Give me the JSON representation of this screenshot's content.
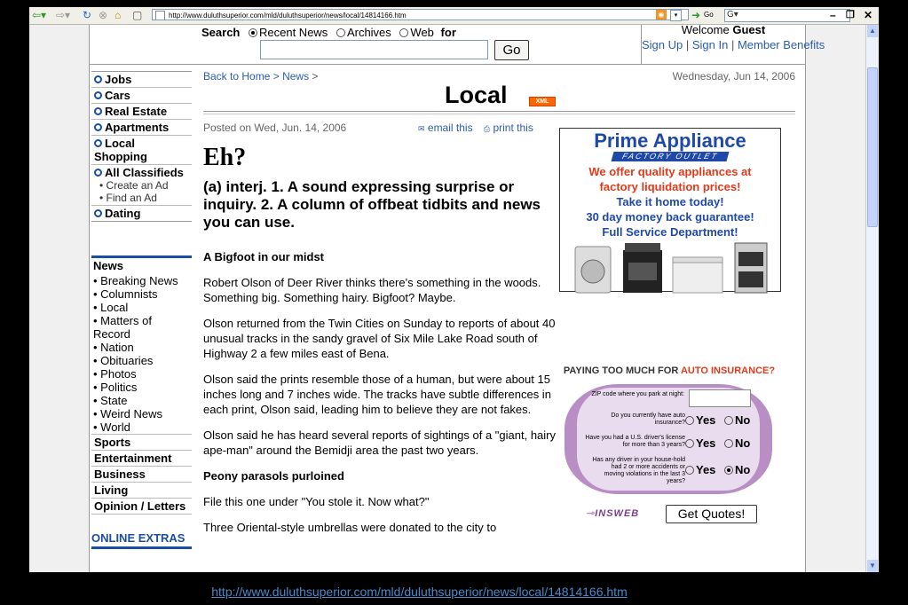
{
  "browser": {
    "url": "http://www.duluthsuperior.com/mld/duluthsuperior/news/local/14814166.htm",
    "go_label": "Go"
  },
  "header": {
    "search_label": "Search",
    "radio_options": [
      "Recent News",
      "Archives",
      "Web"
    ],
    "for_label": "for",
    "go_button": "Go",
    "welcome_prefix": "Welcome",
    "welcome_user": "Guest",
    "links": [
      "Sign Up",
      "Sign In",
      "Member Benefits"
    ]
  },
  "nav": {
    "classified": [
      "Jobs",
      "Cars",
      "Real Estate",
      "Apartments",
      "Local Shopping",
      "All Classifieds"
    ],
    "classified_sub": [
      "Create an Ad",
      "Find an Ad"
    ],
    "dating": "Dating",
    "news_title": "News",
    "news_items": [
      "Breaking News",
      "Columnists",
      "Local",
      "Matters of Record",
      "Nation",
      "Obituaries",
      "Photos",
      "Politics",
      "State",
      "Weird News",
      "World"
    ],
    "sections": [
      "Sports",
      "Entertainment",
      "Business",
      "Living",
      "Opinion / Letters"
    ],
    "online_extras": "ONLINE EXTRAS"
  },
  "content": {
    "breadcrumb": [
      "Back to Home >",
      "News",
      ">"
    ],
    "date": "Wednesday, Jun 14, 2006",
    "section_title": "Local",
    "xml_badge": "XML",
    "posted": "Posted on Wed, Jun. 14, 2006",
    "email_label": "email this",
    "print_label": "print this",
    "headline": "Eh?",
    "deck": "(a) interj. 1. A sound expressing surprise or inquiry. 2. A column of offbeat tidbits and news you can use.",
    "subhead1": "A Bigfoot in our midst",
    "paragraphs1": [
      "Robert Olson of Deer River thinks there's something in the woods. Something big. Something hairy. Bigfoot? Maybe.",
      "Olson returned from the Twin Cities on Sunday to reports of about 40 unusual tracks in the sandy gravel of Six Mile Lake Road south of Highway 2 a few miles east of Bena.",
      "Olson said the prints resemble those of a human, but were about 15 inches long and 7 inches wide. The tracks have subtle differences in each print, Olson said, leading him to believe they are not fakes.",
      "Olson said he has heard several reports of sightings of a \"giant, hairy ape-man\" around the Bemidji area the past two years."
    ],
    "subhead2": "Peony parasols purloined",
    "paragraphs2": [
      "File this one under \"You stole it. Now what?\"",
      "Three Oriental-style umbrellas were donated to the city to"
    ]
  },
  "ad1": {
    "brand": "Prime Appliance",
    "tag": "FACTORY OUTLET",
    "lines": [
      "We offer quality appliances at",
      "factory liquidation prices!",
      "Take it home today!",
      "30 day money back guarantee!",
      "Full Service Department!"
    ]
  },
  "ad2": {
    "title_prefix": "PAYING TOO MUCH FOR",
    "title_hl": "AUTO INSURANCE?",
    "zip_label": "ZIP code where you park at night:",
    "q1": "Do you currently have auto insurance?",
    "q2": "Have you had a U.S. driver's license for more than 3 years?",
    "q3": "Has any driver in your house-hold had 2 or more accidents or moving violations in the last 3 years?",
    "yes": "Yes",
    "no": "No",
    "brand": "INSWEB",
    "cta": "Get Quotes!"
  },
  "caption_url": "http://www.duluthsuperior.com/mld/duluthsuperior/news/local/14814166.htm",
  "colors": {
    "link": "#2a5db0",
    "nav_bullet": "#1a4ea0",
    "ad_blue": "#1f49a8",
    "ad_red": "#e03a1a"
  }
}
